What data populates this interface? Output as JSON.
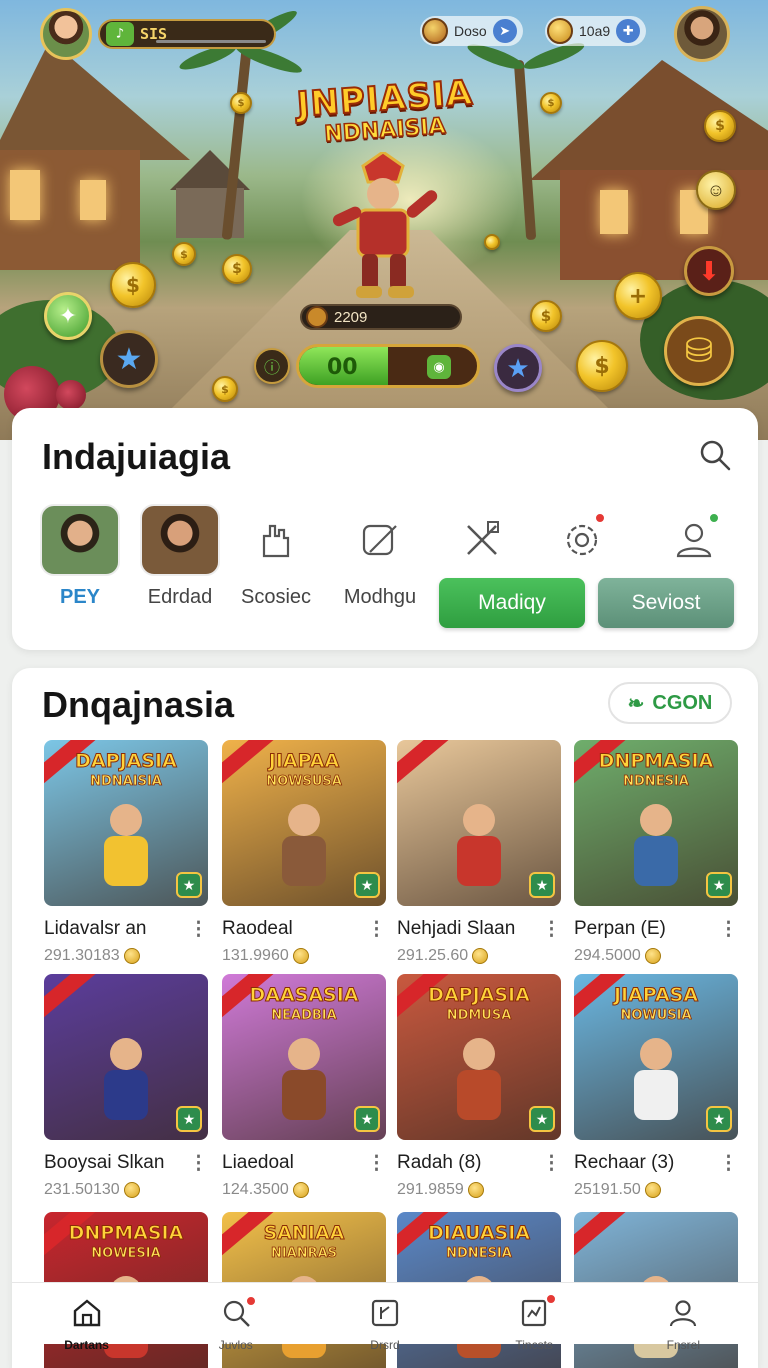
{
  "hud": {
    "level_text": "SIS",
    "resource_1_label": "Doso",
    "resource_2_label": "10a9",
    "score_value": "2209",
    "energy_value": "00",
    "energy_fill": 0.5
  },
  "hero": {
    "logo_line1": "JNPIASIA",
    "logo_line2": "NDNAISIA"
  },
  "menu": {
    "title": "Indajuiagia",
    "shortcuts": [
      {
        "label": "PEY",
        "active": true
      },
      {
        "label": "Edrdad"
      },
      {
        "label": "Scosiec"
      },
      {
        "label": "Modhgu"
      }
    ],
    "primary_button": "Madiqy",
    "secondary_button": "Seviost"
  },
  "games": {
    "title": "Dnqajnasia",
    "chip_label": "CGON",
    "tiles": [
      {
        "name": "Lidavalsr an",
        "meta": "291.30183",
        "t1": "DAPJASIA",
        "t2": "NDNAISIA",
        "bg": "#7cc6e6"
      },
      {
        "name": "Raodeal",
        "meta": "131.9960",
        "t1": "JIAPAA",
        "t2": "NOWSUSA",
        "bg": "#f0b24a"
      },
      {
        "name": "Nehjadi Slaan",
        "meta": "291.25.60",
        "t1": "",
        "t2": "",
        "bg": "#e8c79a"
      },
      {
        "name": "Perpan (E)",
        "meta": "294.5000",
        "t1": "DNPMASIA",
        "t2": "NDNESIA",
        "bg": "#6fae6c"
      },
      {
        "name": "Booysai Slkan",
        "meta": "231.50130",
        "t1": "",
        "t2": "",
        "bg": "#5b3d9c"
      },
      {
        "name": "Liaedoal",
        "meta": "124.3500",
        "t1": "DAASASIA",
        "t2": "NEADBIA",
        "bg": "#d07ad8"
      },
      {
        "name": "Radah (8)",
        "meta": "291.9859",
        "t1": "DAPJASIA",
        "t2": "NDMUSA",
        "bg": "#c9593f"
      },
      {
        "name": "Rechaar (3)",
        "meta": "25191.50",
        "t1": "JIAPASA",
        "t2": "NOWUSIA",
        "bg": "#6ab7e2"
      },
      {
        "name": "",
        "meta": "",
        "t1": "DNPMASIA",
        "t2": "NOWESIA",
        "bg": "#c8262e"
      },
      {
        "name": "",
        "meta": "",
        "t1": "SANIAA",
        "t2": "NIANRAS",
        "bg": "#f2c04a"
      },
      {
        "name": "",
        "meta": "",
        "t1": "DIAUASIA",
        "t2": "NDNESIA",
        "bg": "#5a88c8"
      },
      {
        "name": "",
        "meta": "",
        "t1": "",
        "t2": "",
        "bg": "#7fb4d8"
      }
    ]
  },
  "bottom_nav": [
    {
      "label": "Dartans",
      "icon": "home-icon"
    },
    {
      "label": "Juvlos",
      "icon": "search-icon"
    },
    {
      "label": "Drsrd",
      "icon": "square-icon"
    },
    {
      "label": "Tincsts",
      "icon": "ticket-icon"
    },
    {
      "label": "Fnsrel",
      "icon": "profile-icon"
    }
  ],
  "colors": {
    "accent_green": "#3db04f",
    "accent_blue": "#2b86c9",
    "alert_red": "#e53935"
  }
}
